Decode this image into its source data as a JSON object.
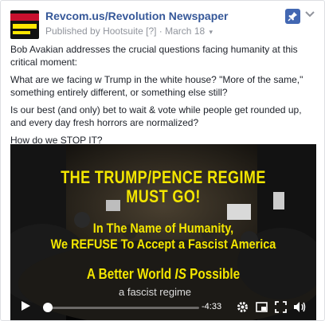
{
  "post": {
    "page_name": "Revcom.us/Revolution Newspaper",
    "published_by_prefix": "Published by",
    "publisher": "Hootsuite",
    "publisher_badge": "[?]",
    "separator": "·",
    "date": "March 18"
  },
  "text": {
    "p1": "Bob Avakian addresses the crucial questions facing humanity at this critical moment:",
    "p2": "What are we facing w Trump in the white house? \"More of the same,\" something entirely different, or something else still?",
    "p3": "Is our best (and only) bet to wait & vote while people get rounded up, and every day fresh horrors are normalized?",
    "p4": "How do we STOP IT?"
  },
  "video": {
    "headline1_line1": "THE TRUMP/PENCE REGIME",
    "headline1_line2": "MUST GO!",
    "headline2_line1": "In The Name of Humanity,",
    "headline2_line2": "We REFUSE To Accept a Fascist America",
    "headline3_before": "A Better World ",
    "headline3_emph": "IS",
    "headline3_after": " Possible",
    "caption": "a fascist regime",
    "time_remaining": "-4:33",
    "progress": 0.0
  },
  "icons": {
    "pin": "pin-icon",
    "more": "chevron-down-icon",
    "play": "play-icon",
    "settings": "gear-icon",
    "pip": "picture-in-picture-icon",
    "fullscreen": "fullscreen-icon",
    "volume": "volume-icon"
  },
  "colors": {
    "link": "#365899",
    "accent": "#4267b2",
    "headline": "#f3e600",
    "meta": "#90949c"
  }
}
